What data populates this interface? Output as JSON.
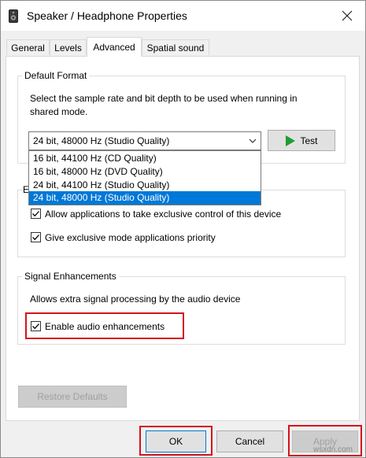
{
  "window": {
    "title": "Speaker / Headphone Properties",
    "close_glyph": "✕"
  },
  "tabs": [
    {
      "label": "General",
      "active": false
    },
    {
      "label": "Levels",
      "active": false
    },
    {
      "label": "Advanced",
      "active": true
    },
    {
      "label": "Spatial sound",
      "active": false
    }
  ],
  "default_format": {
    "group_title": "Default Format",
    "description_line1": "Select the sample rate and bit depth to be used when running in",
    "description_line2": "shared mode.",
    "selected_value": "24 bit, 48000 Hz (Studio Quality)",
    "test_button_label": "Test",
    "options": [
      {
        "label": "16 bit, 44100 Hz (CD Quality)",
        "selected": false
      },
      {
        "label": "16 bit, 48000 Hz (DVD Quality)",
        "selected": false
      },
      {
        "label": "24 bit, 44100 Hz (Studio Quality)",
        "selected": false
      },
      {
        "label": "24 bit, 48000 Hz (Studio Quality)",
        "selected": true
      }
    ]
  },
  "exclusive_mode": {
    "group_title_partial": "E",
    "allow_exclusive_label": "Allow applications to take exclusive control of this device",
    "allow_exclusive_checked": true,
    "priority_label": "Give exclusive mode applications priority",
    "priority_checked": true
  },
  "signal_enhancements": {
    "group_title": "Signal Enhancements",
    "description": "Allows extra signal processing by the audio device",
    "enable_label": "Enable audio enhancements",
    "enable_checked": true
  },
  "footer": {
    "restore_defaults_label": "Restore Defaults",
    "ok_label": "OK",
    "cancel_label": "Cancel",
    "apply_label": "Apply"
  },
  "watermark": "wsxdn.com",
  "colors": {
    "selection_blue": "#0078d7",
    "highlight_red": "#d3141a",
    "play_green": "#1e9e32"
  }
}
